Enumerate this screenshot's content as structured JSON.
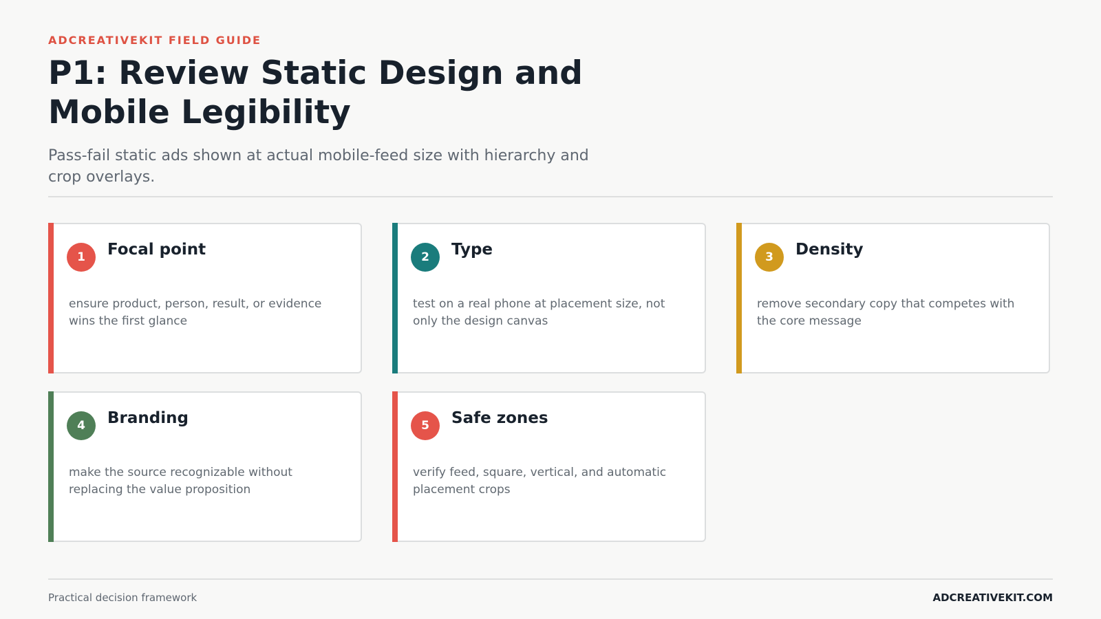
{
  "header": {
    "eyebrow": "ADCREATIVEKIT FIELD GUIDE",
    "title": "P1: Review Static Design and Mobile Legibility",
    "subtitle": "Pass-fail static ads shown at actual mobile-feed size with hierarchy and crop overlays."
  },
  "cards": [
    {
      "number": "1",
      "title": "Focal point",
      "body": "ensure product, person, result, or evidence wins the first glance",
      "accent_color": "#e5544a"
    },
    {
      "number": "2",
      "title": "Type",
      "body": "test on a real phone at placement size, not only the design canvas",
      "accent_color": "#1a7c7c"
    },
    {
      "number": "3",
      "title": "Density",
      "body": "remove secondary copy that competes with the core message",
      "accent_color": "#d19a1e"
    },
    {
      "number": "4",
      "title": "Branding",
      "body": "make the source recognizable without replacing the value proposition",
      "accent_color": "#4f7f57"
    },
    {
      "number": "5",
      "title": "Safe zones",
      "body": "verify feed, square, vertical, and automatic placement crops",
      "accent_color": "#e5544a"
    }
  ],
  "footer": {
    "left": "Practical decision framework",
    "right": "ADCREATIVEKIT.COM"
  }
}
